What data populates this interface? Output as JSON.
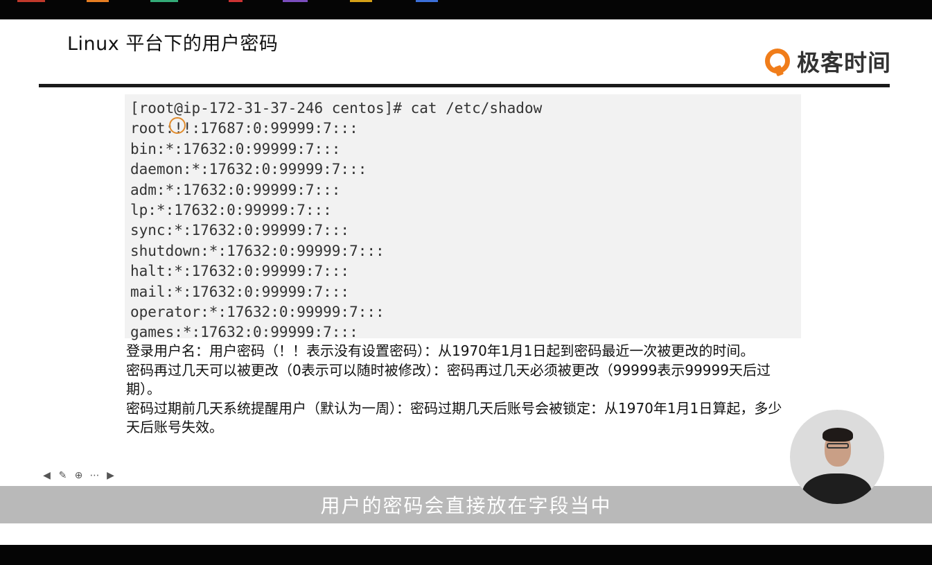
{
  "slide": {
    "title": "Linux 平台下的用户密码",
    "brand": "极客时间",
    "terminal_lines": [
      "[root@ip-172-31-37-246 centos]# cat /etc/shadow",
      "root:!!:17687:0:99999:7:::",
      "bin:*:17632:0:99999:7:::",
      "daemon:*:17632:0:99999:7:::",
      "adm:*:17632:0:99999:7:::",
      "lp:*:17632:0:99999:7:::",
      "sync:*:17632:0:99999:7:::",
      "shutdown:*:17632:0:99999:7:::",
      "halt:*:17632:0:99999:7:::",
      "mail:*:17632:0:99999:7:::",
      "operator:*:17632:0:99999:7:::",
      "games:*:17632:0:99999:7:::"
    ],
    "notes": [
      "登录用户名：用户密码（！！表示没有设置密码）：从1970年1月1日起到密码最近一次被更改的时间。",
      "密码再过几天可以被更改（0表示可以随时被修改）：密码再过几天必须被更改（99999表示99999天后过期）。",
      "密码过期前几天系统提醒用户（默认为一周）：密码过期几天后账号会被锁定：从1970年1月1日算起，多少天后账号失效。"
    ]
  },
  "controls": {
    "prev_icon": "arrow-left-icon",
    "pen_icon": "pen-icon",
    "zoom_icon": "zoom-icon",
    "more_icon": "more-icon",
    "next_icon": "arrow-right-icon"
  },
  "subtitle": "用户的密码会直接放在字段当中",
  "colors": {
    "brand_orange": "#f07d1a",
    "terminal_bg": "#f2f2f2",
    "subtitle_band": "#b9b9b9"
  }
}
